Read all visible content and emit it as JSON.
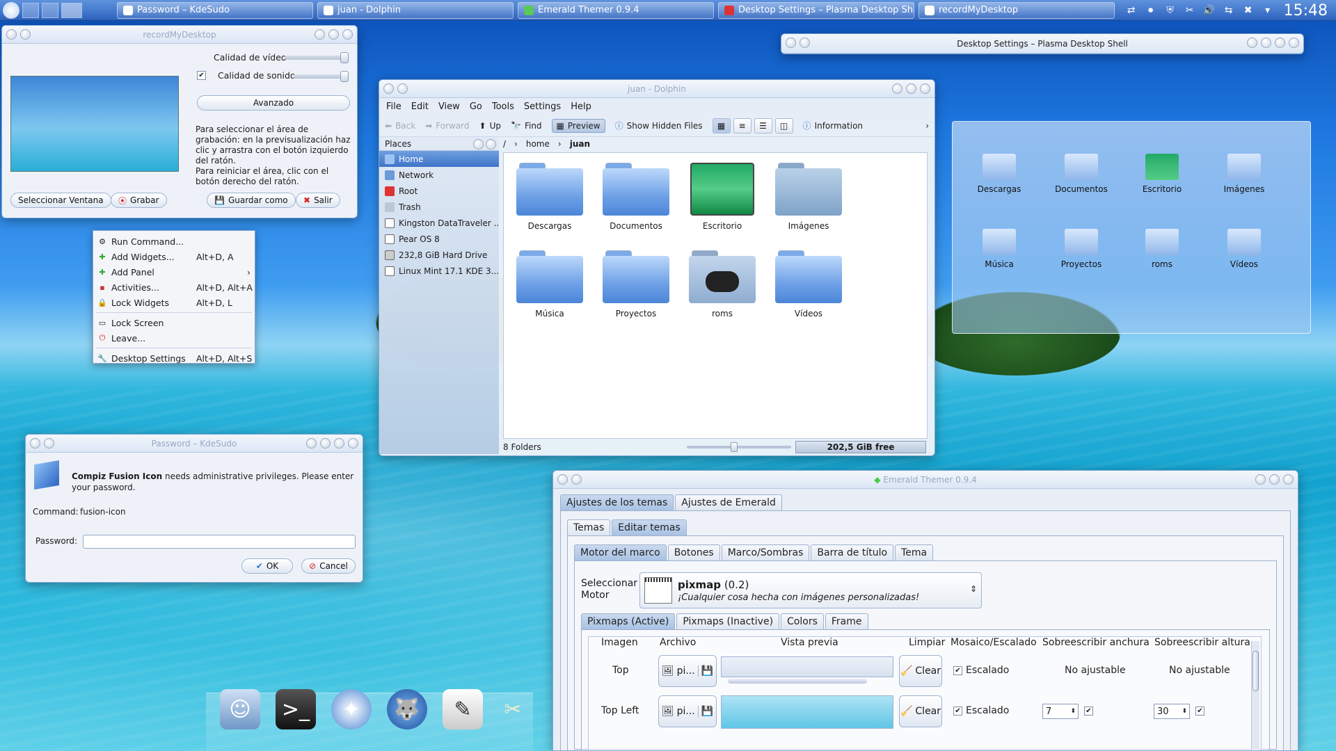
{
  "taskbar": {
    "tasks": [
      {
        "label": "Password – KdeSudo"
      },
      {
        "label": "juan - Dolphin"
      },
      {
        "label": "Emerald Themer 0.9.4"
      },
      {
        "label": "Desktop Settings – Plasma Desktop Shell"
      },
      {
        "label": "recordMyDesktop"
      }
    ],
    "clock": "15:48"
  },
  "recordmydesktop": {
    "title": "recordMyDesktop",
    "video_quality_label": "Calidad de vídeo",
    "video_quality": 0.95,
    "sound_quality_label": "Calidad de sonido",
    "sound_quality": 0.95,
    "advanced_button": "Avanzado",
    "help1": "Para seleccionar el área de grabación: en la previsualización haz clic y arrastra con el botón izquierdo del ratón.",
    "help2": "Para reiniciar el área, clic con el botón derecho del ratón.",
    "select_window_button": "Seleccionar Ventana",
    "record_button": "Grabar",
    "save_as_button": "Guardar como",
    "quit_button": "Salir"
  },
  "context_menu": {
    "items": [
      {
        "label": "Run Command...",
        "shortcut": ""
      },
      {
        "label": "Add Widgets...",
        "shortcut": "Alt+D, A"
      },
      {
        "label": "Add Panel",
        "shortcut": ""
      },
      {
        "label": "Activities...",
        "shortcut": "Alt+D, Alt+A"
      },
      {
        "label": "Lock Widgets",
        "shortcut": "Alt+D, L"
      },
      {
        "label": "Lock Screen",
        "shortcut": ""
      },
      {
        "label": "Leave...",
        "shortcut": ""
      },
      {
        "label": "Desktop Settings",
        "shortcut": "Alt+D, Alt+S"
      }
    ]
  },
  "dolphin": {
    "title": "juan - Dolphin",
    "menu": [
      "File",
      "Edit",
      "View",
      "Go",
      "Tools",
      "Settings",
      "Help"
    ],
    "toolbar": {
      "back": "Back",
      "forward": "Forward",
      "up": "Up",
      "find": "Find",
      "preview": "Preview",
      "show_hidden": "Show Hidden Files",
      "information": "Information"
    },
    "places_header": "Places",
    "places": [
      "Home",
      "Network",
      "Root",
      "Trash",
      "Kingston DataTraveler ...",
      "Pear OS 8",
      "232,8 GiB Hard Drive",
      "Linux Mint 17.1 KDE 3..."
    ],
    "breadcrumb": [
      "/",
      "home",
      "juan"
    ],
    "files": [
      "Descargas",
      "Documentos",
      "Escritorio",
      "Imágenes",
      "Música",
      "Proyectos",
      "roms",
      "Vídeos"
    ],
    "status": "8 Folders",
    "free_space": "202,5 GiB free",
    "zoom": 0.45
  },
  "desktop_settings": {
    "title": "Desktop Settings – Plasma Desktop Shell"
  },
  "folder_view": {
    "items": [
      "Descargas",
      "Documentos",
      "Escritorio",
      "Imágenes",
      "Música",
      "Proyectos",
      "roms",
      "Vídeos"
    ]
  },
  "kdesudo": {
    "title": "Password – KdeSudo",
    "message_app": "Compiz Fusion Icon",
    "message_rest": " needs administrative privileges. Please enter your password.",
    "command_label": "Command:",
    "command_value": "fusion-icon",
    "password_label": "Password:",
    "password_value": "",
    "ok_button": "OK",
    "cancel_button": "Cancel"
  },
  "emerald": {
    "title": "Emerald Themer 0.9.4",
    "top_tabs": [
      "Ajustes de los temas",
      "Ajustes de Emerald"
    ],
    "sub_tabs": [
      "Temas",
      "Editar temas"
    ],
    "edit_tabs": [
      "Motor del marco",
      "Botones",
      "Marco/Sombras",
      "Barra de título",
      "Tema"
    ],
    "engine_label": "Seleccionar Motor",
    "engine_name": "pixmap",
    "engine_version": "(0.2)",
    "engine_desc": "¡Cualquier cosa hecha con imágenes personalizadas!",
    "pixmap_tabs": [
      "Pixmaps (Active)",
      "Pixmaps (Inactive)",
      "Colors",
      "Frame"
    ],
    "columns": [
      "Imagen",
      "Archivo",
      "Vista previa",
      "Limpiar",
      "Mosaico/Escalado",
      "Sobreescribir anchura",
      "Sobreescribir altura"
    ],
    "rows": [
      {
        "image": "Top",
        "file": "pi...",
        "clear": "Clear",
        "scale": "Escalado",
        "width": "No ajustable",
        "height": "No ajustable"
      },
      {
        "image": "Top Left",
        "file": "pi...",
        "clear": "Clear",
        "scale": "Escalado",
        "width": "7",
        "height": "30"
      }
    ]
  },
  "colors": {
    "accent": "#3e74c8",
    "titlebar": "#dbe6f5"
  }
}
